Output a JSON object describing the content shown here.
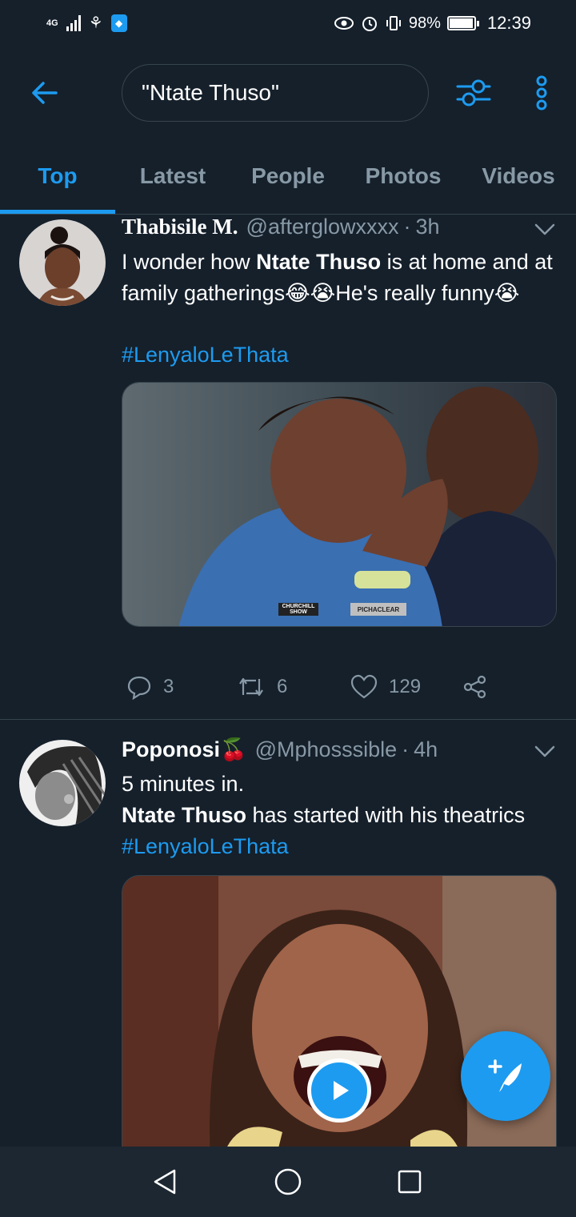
{
  "status_bar": {
    "network": "4G",
    "battery": "98%",
    "battery_level": 0.98,
    "time": "12:39"
  },
  "search": {
    "query": "\"Ntate Thuso\""
  },
  "tabs": [
    {
      "label": "Top",
      "active": true
    },
    {
      "label": "Latest",
      "active": false
    },
    {
      "label": "People",
      "active": false
    },
    {
      "label": "Photos",
      "active": false
    },
    {
      "label": "Videos",
      "active": false
    }
  ],
  "tweets": [
    {
      "author": "Thabisile M.",
      "handle": "@afterglowxxxx",
      "separator": "·",
      "time": "3h",
      "text_1": "I wonder how ",
      "text_bold": "Ntate Thuso",
      "text_2": " is at home and at family gatherings😂😭He's really funny😭",
      "hashtag": "#LenyaloLeThata",
      "media_watermark_1": "CHURCHILL",
      "media_watermark_1b": "SHOW",
      "media_watermark_2": "PICHACLEAR",
      "replies": "3",
      "retweets": "6",
      "likes": "129"
    },
    {
      "author": "Poponosi",
      "author_emoji": "🍒",
      "handle": "@Mphosssible",
      "separator": "·",
      "time": "4h",
      "line_1": "5 minutes in.",
      "text_bold": "Ntate Thuso",
      "text_2": " has started with his theatrics ",
      "hashtag": "#LenyaloLeThata"
    }
  ],
  "colors": {
    "background": "#15202b",
    "accent": "#1d9bf0",
    "secondary_text": "#8899a6",
    "divider": "#38444d"
  },
  "icons": {
    "back": "arrow-left-icon",
    "filter": "sliders-icon",
    "more": "more-vertical-icon",
    "compose": "feather-plus-icon",
    "play": "play-icon"
  }
}
